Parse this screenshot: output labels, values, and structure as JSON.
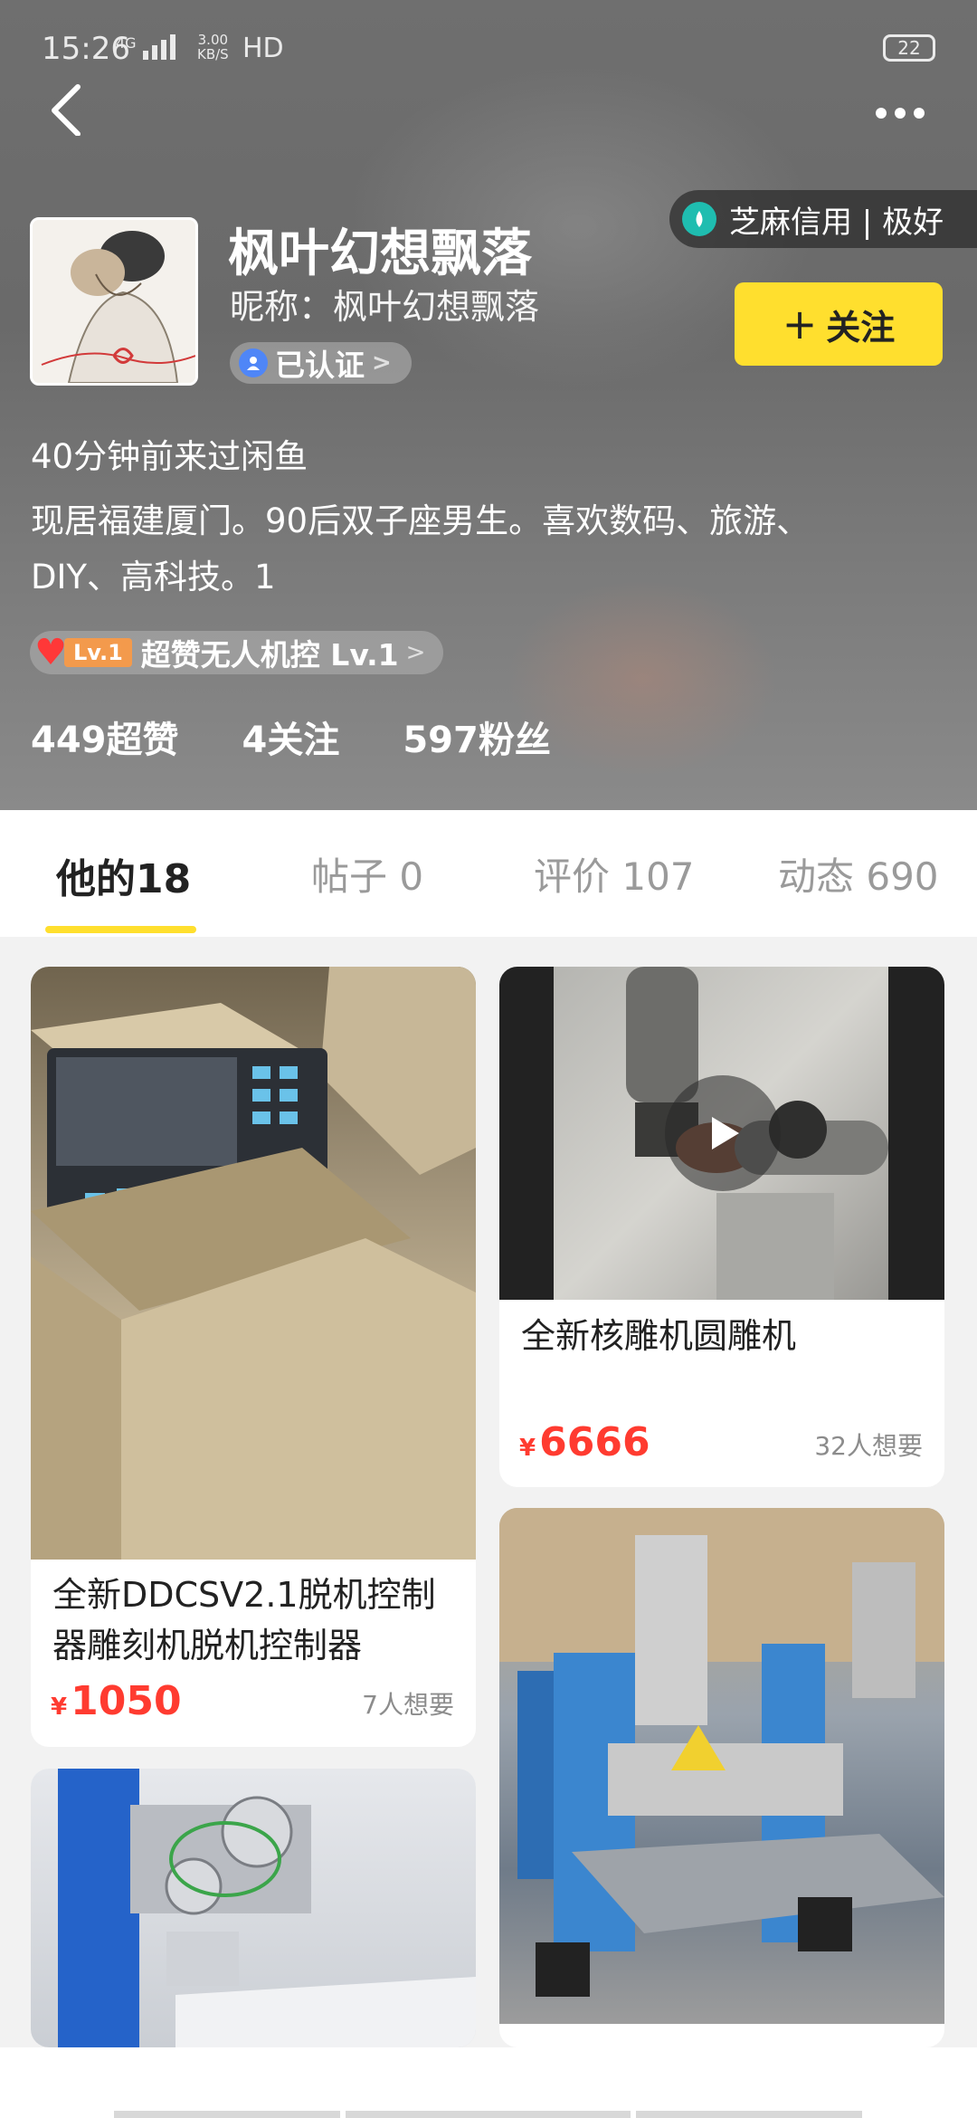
{
  "status": {
    "time": "15:26",
    "network": "4G",
    "speed_top": "3.00",
    "speed_unit": "KB/S",
    "hd": "HD",
    "battery": "22"
  },
  "profile": {
    "name": "枫叶幻想飘落",
    "nickname": "昵称：枫叶幻想飘落",
    "verified_label": "已认证",
    "credit_label": "芝麻信用 | 极好",
    "follow_label": "关注",
    "last_visit": "40分钟前来过闲鱼",
    "bio_line1": "现居福建厦门。90后双子座男生。喜欢数码、旅游、",
    "bio_line2": "DIY、高科技。1",
    "level_badge": "Lv.1",
    "level_text": "超赞无人机控 Lv.1"
  },
  "stats": {
    "likes": "449超赞",
    "following": "4关注",
    "fans": "597粉丝"
  },
  "tabs": [
    {
      "label": "他的18"
    },
    {
      "label": "帖子 0"
    },
    {
      "label": "评价 107"
    },
    {
      "label": "动态 690"
    }
  ],
  "items": [
    {
      "title_line1": "全新DDCSV2.1脱机控制",
      "title_line2": "器雕刻机脱机控制器",
      "currency": "¥",
      "price": "1050",
      "wants": "7人想要"
    },
    {
      "title_line1": "全新核雕机圆雕机",
      "currency": "¥",
      "price": "6666",
      "wants": "32人想要"
    }
  ],
  "icons": {
    "back": "chevron-left-icon",
    "more": "more-dots-icon",
    "play": "play-icon"
  },
  "colors": {
    "accent_yellow": "#ffdf2e",
    "price_red": "#ff3b30",
    "credit_teal": "#1fbdb0"
  }
}
